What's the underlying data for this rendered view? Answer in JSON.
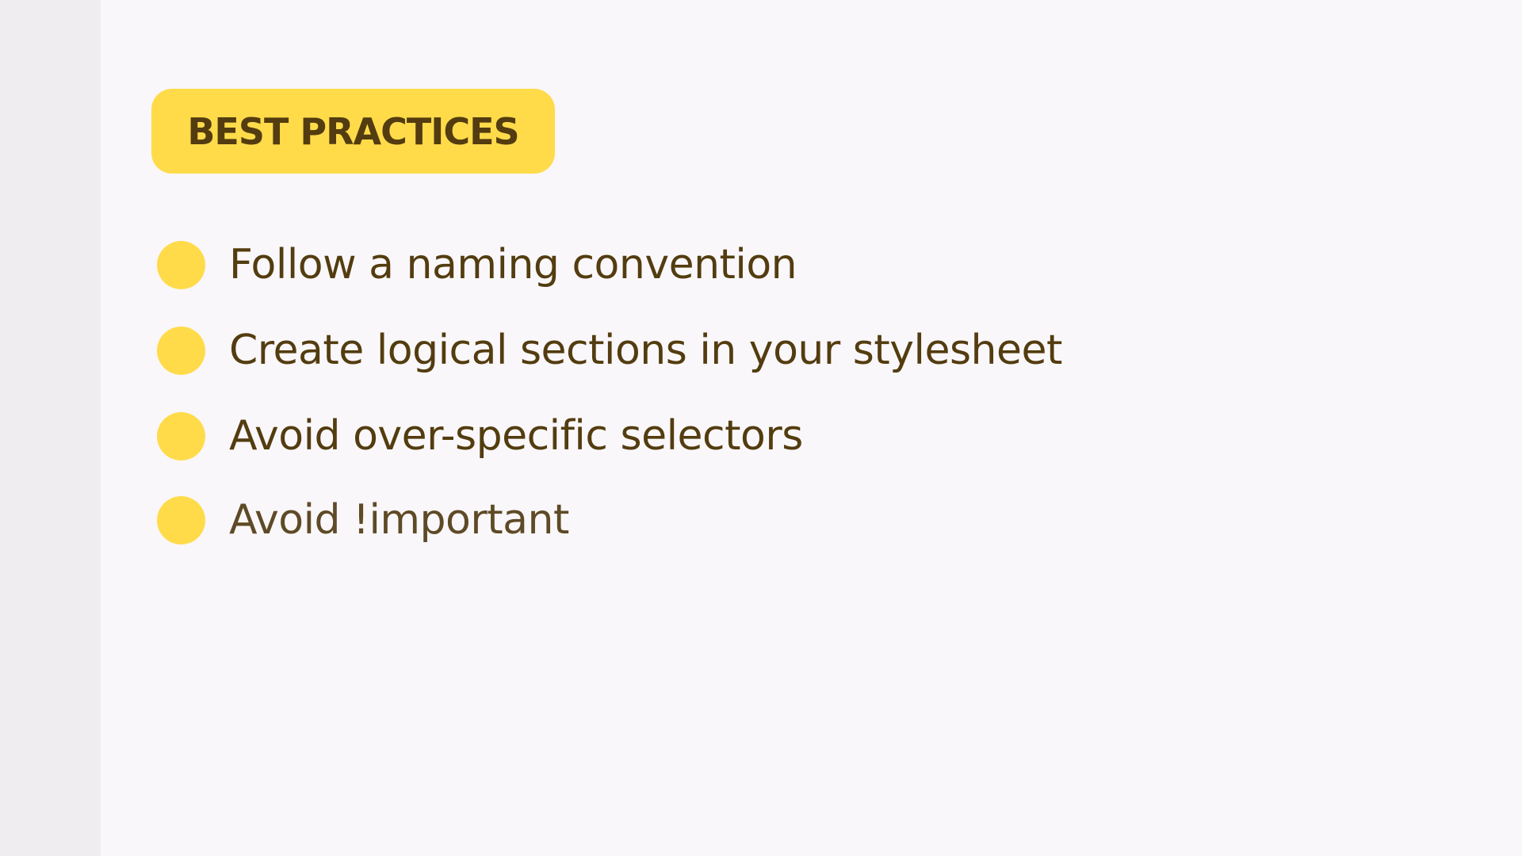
{
  "colors": {
    "accent": "#ffdb4a",
    "text": "#533c0f",
    "text_faded": "#5e4a26",
    "sidebar_bg": "#efedf0",
    "main_bg": "#f9f7fa"
  },
  "badge": {
    "label": "BEST PRACTICES"
  },
  "list": {
    "items": [
      {
        "label": "Follow a naming convention",
        "icon": "bullet-dot"
      },
      {
        "label": "Create logical sections in your stylesheet",
        "icon": "bullet-dot"
      },
      {
        "label": "Avoid over-specific selectors",
        "icon": "bullet-dot"
      },
      {
        "label": "Avoid !important",
        "icon": "bullet-dot"
      }
    ]
  }
}
